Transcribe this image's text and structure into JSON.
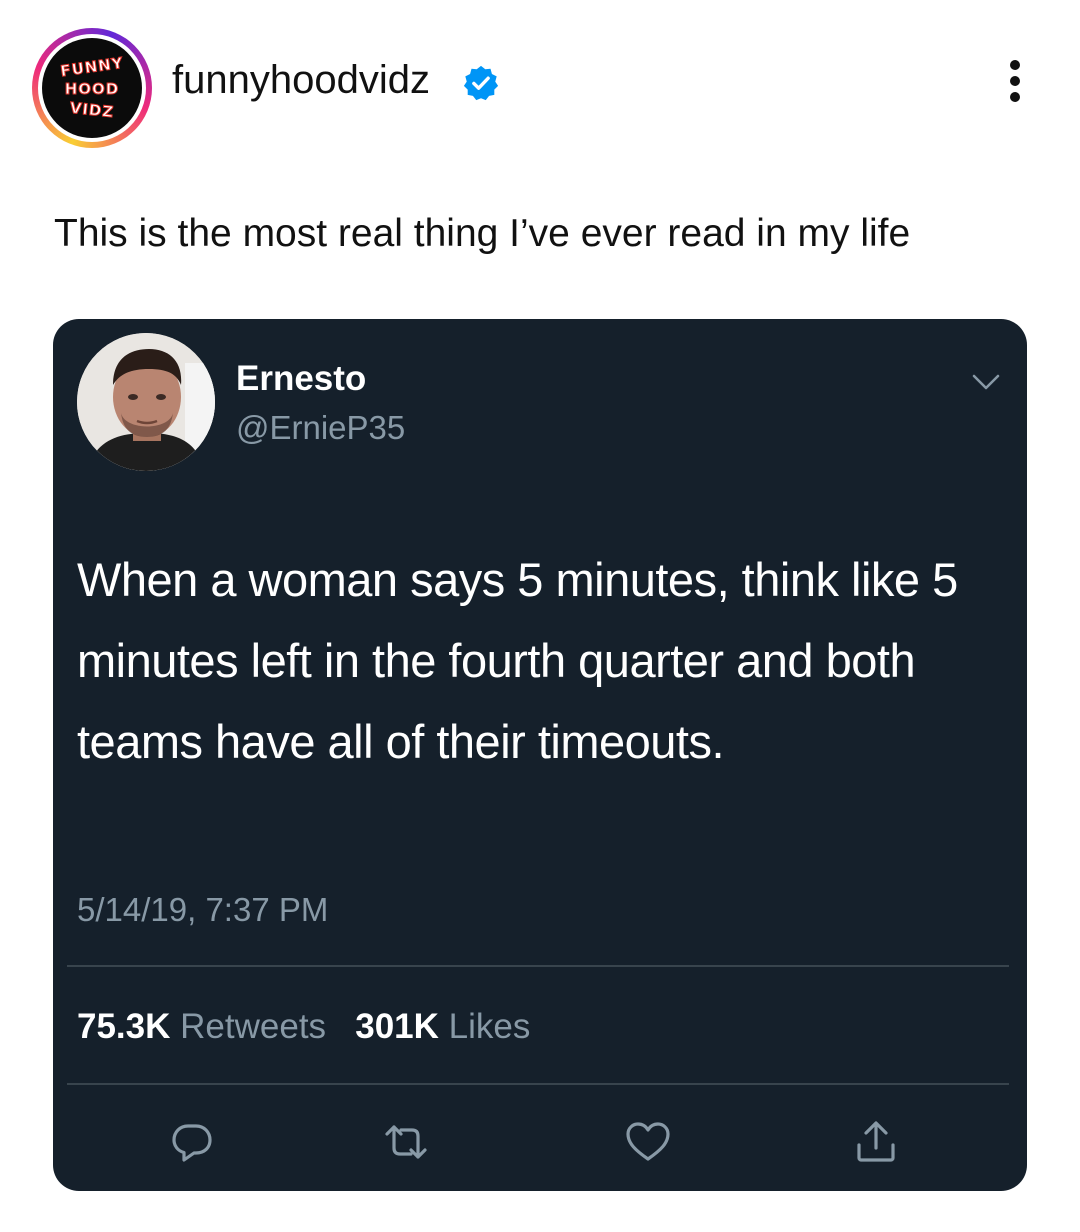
{
  "header": {
    "username": "funnyhoodvidz",
    "avatar_text": [
      "FUNNY",
      "HOOD",
      "VIDZ"
    ],
    "avatar_icon": "profile-logo",
    "verified_icon": "verified-badge-icon",
    "more_icon": "more-vertical-icon"
  },
  "caption": "This is the most real thing I’ve ever read in my life",
  "tweet": {
    "name": "Ernesto",
    "handle": "@ErnieP35",
    "text": "When a woman says 5 minutes, think like 5 minutes left in the fourth quarter and both teams have all of their timeouts.",
    "timestamp": "5/14/19, 7:37 PM",
    "retweets_count": "75.3K",
    "retweets_label": "Retweets",
    "likes_count": "301K",
    "likes_label": "Likes",
    "actions": [
      "reply-icon",
      "retweet-icon",
      "like-icon",
      "share-icon"
    ]
  },
  "colors": {
    "card_bg": "#15202b",
    "secondary_text": "#8899a6",
    "verified_blue": "#0095f6"
  }
}
